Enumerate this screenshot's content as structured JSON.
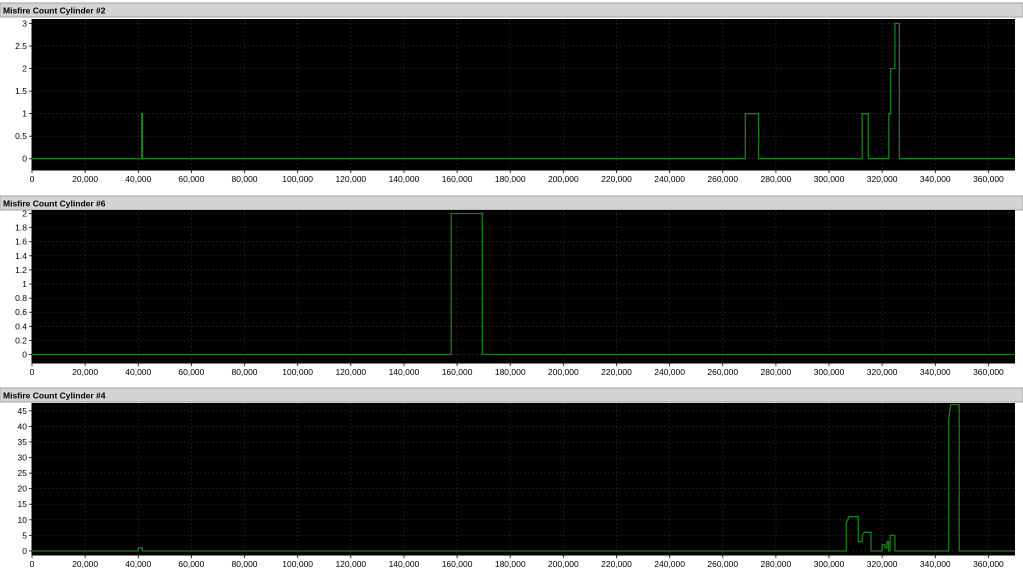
{
  "colors": {
    "title_bar_bg": "#d4d4d4",
    "plot_bg": "#000000",
    "grid": "#3a3a3a",
    "trace": "#1e7a1e",
    "axis_text": "#000000",
    "panel_bg": "#ffffff"
  },
  "chart_data": [
    {
      "type": "line",
      "title": "Misfire Count Cylinder #2",
      "xlim": [
        0,
        370000
      ],
      "ylim": [
        -0.25,
        3.1
      ],
      "xticks": [
        0,
        20000,
        40000,
        60000,
        80000,
        100000,
        120000,
        140000,
        160000,
        180000,
        200000,
        220000,
        240000,
        260000,
        280000,
        300000,
        320000,
        340000,
        360000
      ],
      "xtick_labels": [
        "0",
        "20,000",
        "40,000",
        "60,000",
        "80,000",
        "100,000",
        "120,000",
        "140,000",
        "160,000",
        "180,000",
        "200,000",
        "220,000",
        "240,000",
        "260,000",
        "280,000",
        "300,000",
        "320,000",
        "340,000",
        "360,000"
      ],
      "yticks": [
        0,
        0.5,
        1,
        1.5,
        2,
        2.5,
        3
      ],
      "ytick_labels": [
        "0",
        "0.5",
        "1",
        "1.5",
        "2",
        "2.5",
        "3"
      ],
      "grid": true,
      "series": [
        {
          "x": [
            0,
            41300,
            41300,
            41600,
            41600,
            268500,
            268500,
            273500,
            273500,
            312500,
            312500,
            314800,
            314800,
            322500,
            322500,
            323200,
            323200,
            324000,
            324000,
            324800,
            324800,
            326500,
            326500,
            370000
          ],
          "y": [
            0,
            0,
            1,
            1,
            0,
            0,
            1,
            1,
            0,
            0,
            1,
            1,
            0,
            0,
            1,
            1,
            2,
            2,
            2,
            2,
            3,
            3,
            0,
            0
          ]
        }
      ]
    },
    {
      "type": "line",
      "title": "Misfire Count Cylinder #6",
      "xlim": [
        0,
        370000
      ],
      "ylim": [
        -0.12,
        2.05
      ],
      "xticks": [
        0,
        20000,
        40000,
        60000,
        80000,
        100000,
        120000,
        140000,
        160000,
        180000,
        200000,
        220000,
        240000,
        260000,
        280000,
        300000,
        320000,
        340000,
        360000
      ],
      "xtick_labels": [
        "0",
        "20,000",
        "40,000",
        "60,000",
        "80,000",
        "100,000",
        "120,000",
        "140,000",
        "160,000",
        "180,000",
        "200,000",
        "220,000",
        "240,000",
        "260,000",
        "280,000",
        "300,000",
        "320,000",
        "340,000",
        "360,000"
      ],
      "yticks": [
        0,
        0.2,
        0.4,
        0.6,
        0.8,
        1,
        1.2,
        1.4,
        1.6,
        1.8,
        2
      ],
      "ytick_labels": [
        "0",
        "0.2",
        "0.4",
        "0.6",
        "0.8",
        "1",
        "1.2",
        "1.4",
        "1.6",
        "1.8",
        "2"
      ],
      "grid": true,
      "series": [
        {
          "x": [
            0,
            157800,
            157800,
            169500,
            169500,
            370000
          ],
          "y": [
            0,
            0,
            2,
            2,
            0,
            0
          ]
        }
      ]
    },
    {
      "type": "line",
      "title": "Misfire Count Cylinder #4",
      "xlim": [
        0,
        370000
      ],
      "ylim": [
        -1.3,
        47.5
      ],
      "xticks": [
        0,
        20000,
        40000,
        60000,
        80000,
        100000,
        120000,
        140000,
        160000,
        180000,
        200000,
        220000,
        240000,
        260000,
        280000,
        300000,
        320000,
        340000,
        360000
      ],
      "xtick_labels": [
        "0",
        "20,000",
        "40,000",
        "60,000",
        "80,000",
        "100,000",
        "120,000",
        "140,000",
        "160,000",
        "180,000",
        "200,000",
        "220,000",
        "240,000",
        "260,000",
        "280,000",
        "300,000",
        "320,000",
        "340,000",
        "360,000"
      ],
      "yticks": [
        0,
        5,
        10,
        15,
        20,
        25,
        30,
        35,
        40,
        45
      ],
      "ytick_labels": [
        "0",
        "5",
        "10",
        "15",
        "20",
        "25",
        "30",
        "35",
        "40",
        "45"
      ],
      "grid": true,
      "series": [
        {
          "x": [
            0,
            40000,
            40000,
            41500,
            41500,
            306500,
            306500,
            307500,
            307500,
            311000,
            311000,
            312500,
            312500,
            313200,
            313200,
            315800,
            315800,
            320000,
            320000,
            321000,
            321000,
            321800,
            321800,
            322400,
            322400,
            323000,
            323000,
            324800,
            324800,
            327000,
            327000,
            345000,
            345000,
            345800,
            345800,
            349000,
            349000,
            370000
          ],
          "y": [
            0,
            0,
            1,
            1,
            0,
            0,
            9,
            11,
            11,
            11,
            3,
            3,
            5,
            6,
            6,
            6,
            0,
            0,
            2,
            2,
            1,
            1,
            3,
            3,
            0,
            0,
            5,
            5,
            0,
            0,
            0,
            0,
            42,
            47,
            47,
            47,
            0,
            0
          ]
        }
      ]
    }
  ]
}
